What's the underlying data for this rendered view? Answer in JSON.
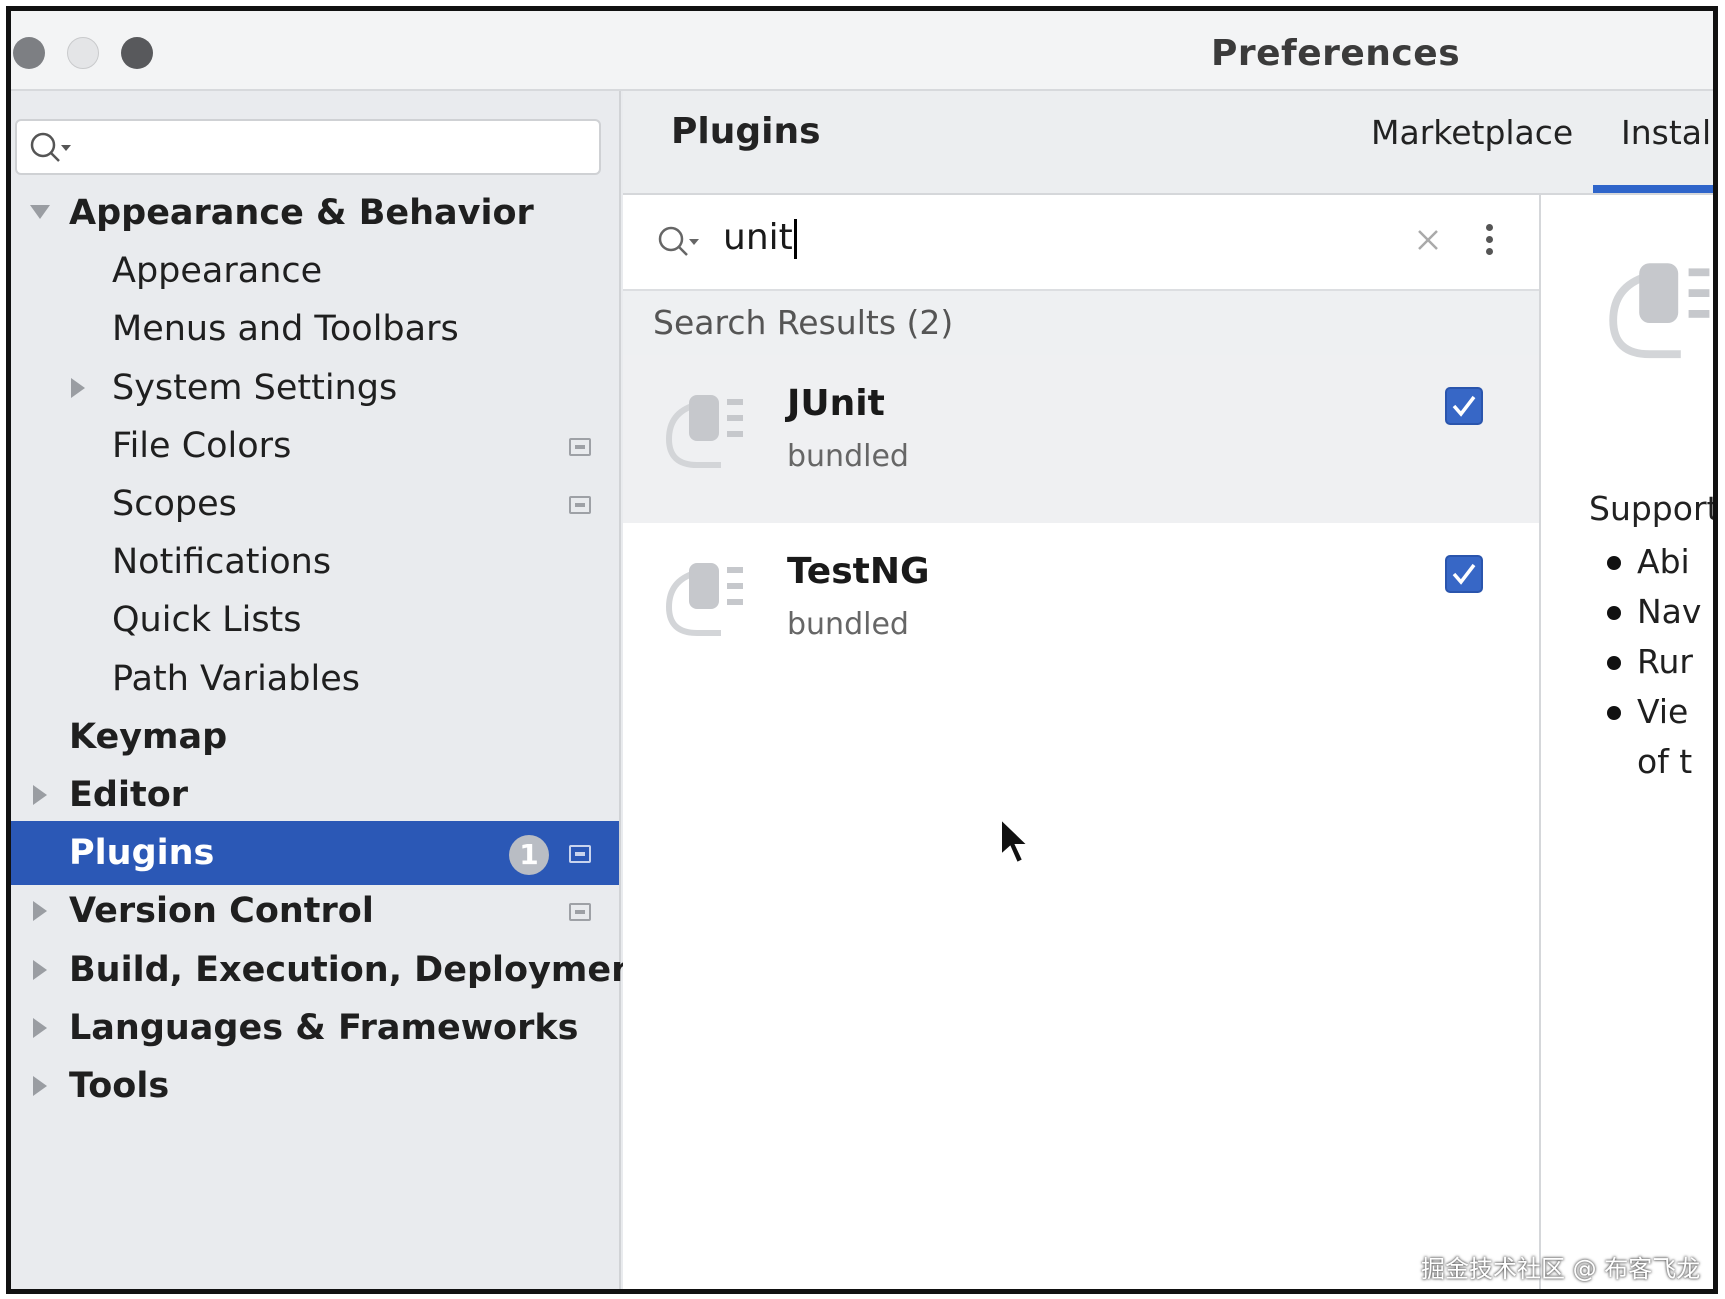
{
  "window": {
    "title": "Preferences",
    "controls": [
      "close",
      "minimize",
      "maximize"
    ]
  },
  "sidebar": {
    "search_placeholder": "",
    "items": [
      {
        "label": "Appearance & Behavior",
        "level": 0,
        "expanded": true,
        "has_arrow": true
      },
      {
        "label": "Appearance",
        "level": 1
      },
      {
        "label": "Menus and Toolbars",
        "level": 1
      },
      {
        "label": "System Settings",
        "level": 1,
        "has_arrow": true
      },
      {
        "label": "File Colors",
        "level": 1,
        "project_icon": true
      },
      {
        "label": "Scopes",
        "level": 1,
        "project_icon": true
      },
      {
        "label": "Notifications",
        "level": 1
      },
      {
        "label": "Quick Lists",
        "level": 1
      },
      {
        "label": "Path Variables",
        "level": 1
      },
      {
        "label": "Keymap",
        "level": 0
      },
      {
        "label": "Editor",
        "level": 0,
        "has_arrow": true
      },
      {
        "label": "Plugins",
        "level": 0,
        "selected": true,
        "badge": "1",
        "project_icon": true
      },
      {
        "label": "Version Control",
        "level": 0,
        "has_arrow": true,
        "project_icon": true
      },
      {
        "label": "Build, Execution, Deployment",
        "level": 0,
        "has_arrow": true
      },
      {
        "label": "Languages & Frameworks",
        "level": 0,
        "has_arrow": true
      },
      {
        "label": "Tools",
        "level": 0,
        "has_arrow": true
      }
    ]
  },
  "plugins": {
    "title": "Plugins",
    "tabs": [
      {
        "label": "Marketplace",
        "active": false
      },
      {
        "label": "Installe",
        "active": true
      }
    ],
    "search": {
      "value": "unit"
    },
    "results_header": "Search Results (2)",
    "results": [
      {
        "name": "JUnit",
        "subtitle": "bundled",
        "enabled": true
      },
      {
        "name": "TestNG",
        "subtitle": "bundled",
        "enabled": true
      }
    ],
    "detail": {
      "heading": "Support",
      "lines": [
        "Abi",
        "Nav",
        "Rur",
        "Vie",
        "of t"
      ]
    }
  },
  "watermark": "掘金技术社区 @ 布客飞龙",
  "colors": {
    "selection": "#2b58b6",
    "accent": "#2f65ca",
    "checkbox": "#3767c6"
  }
}
